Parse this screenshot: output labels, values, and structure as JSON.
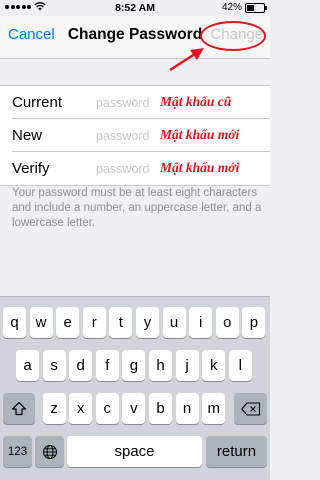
{
  "status": {
    "time": "8:52 AM",
    "battery": "42%"
  },
  "nav": {
    "cancel": "Cancel",
    "title": "Change Password",
    "change": "Change"
  },
  "form": {
    "rows": [
      {
        "label": "Current",
        "placeholder": "password",
        "note": "Mật khẩu cũ"
      },
      {
        "label": "New",
        "placeholder": "password",
        "note": "Mật khẩu mới"
      },
      {
        "label": "Verify",
        "placeholder": "password",
        "note": "Mật khẩu mới"
      }
    ]
  },
  "hint": "Your password must be at least eight characters and include a number, an uppercase letter, and a lowercase letter.",
  "keyboard": {
    "row1": [
      "q",
      "w",
      "e",
      "r",
      "t",
      "y",
      "u",
      "i",
      "o",
      "p"
    ],
    "row2": [
      "a",
      "s",
      "d",
      "f",
      "g",
      "h",
      "j",
      "k",
      "l"
    ],
    "row3": [
      "z",
      "x",
      "c",
      "v",
      "b",
      "n",
      "m"
    ],
    "numbers": "123",
    "space": "space",
    "return": "return",
    "icons": {
      "shift": "shift-icon",
      "delete": "delete-icon",
      "globe": "globe-icon"
    }
  },
  "colors": {
    "accent": "#007aff",
    "annotation": "#e0141e",
    "disabled": "#c7c7cc"
  }
}
